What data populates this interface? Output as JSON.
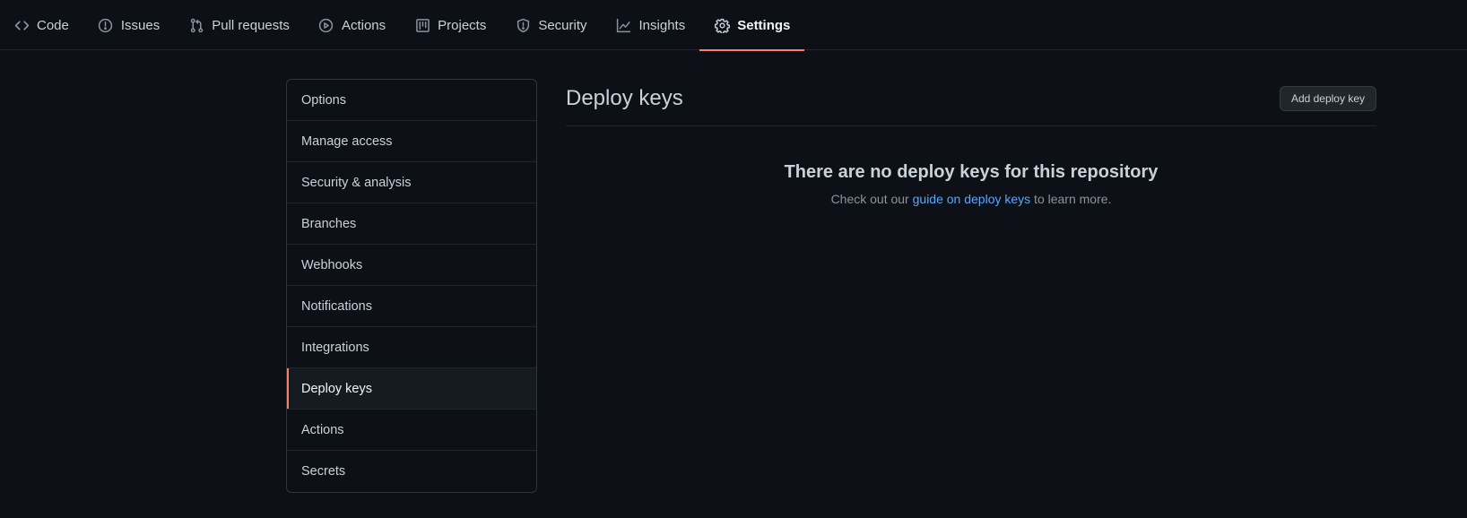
{
  "repo_nav": {
    "tabs": [
      {
        "label": "Code",
        "icon": "code-icon"
      },
      {
        "label": "Issues",
        "icon": "issue-opened-icon"
      },
      {
        "label": "Pull requests",
        "icon": "git-pull-request-icon"
      },
      {
        "label": "Actions",
        "icon": "play-icon"
      },
      {
        "label": "Projects",
        "icon": "project-icon"
      },
      {
        "label": "Security",
        "icon": "shield-icon"
      },
      {
        "label": "Insights",
        "icon": "graph-icon"
      },
      {
        "label": "Settings",
        "icon": "gear-icon",
        "selected": true
      }
    ]
  },
  "settings_menu": {
    "items": [
      {
        "label": "Options"
      },
      {
        "label": "Manage access"
      },
      {
        "label": "Security & analysis"
      },
      {
        "label": "Branches"
      },
      {
        "label": "Webhooks"
      },
      {
        "label": "Notifications"
      },
      {
        "label": "Integrations"
      },
      {
        "label": "Deploy keys",
        "selected": true
      },
      {
        "label": "Actions"
      },
      {
        "label": "Secrets"
      }
    ]
  },
  "main": {
    "title": "Deploy keys",
    "add_button_label": "Add deploy key",
    "empty_state": {
      "title": "There are no deploy keys for this repository",
      "text_before": "Check out our ",
      "link_text": "guide on deploy keys",
      "text_after": " to learn more."
    }
  },
  "colors": {
    "background": "#0d1117",
    "accent": "#f78166",
    "link": "#58a6ff",
    "border": "#30363d",
    "text": "#c9d1d9",
    "muted_text": "#8b949e"
  }
}
